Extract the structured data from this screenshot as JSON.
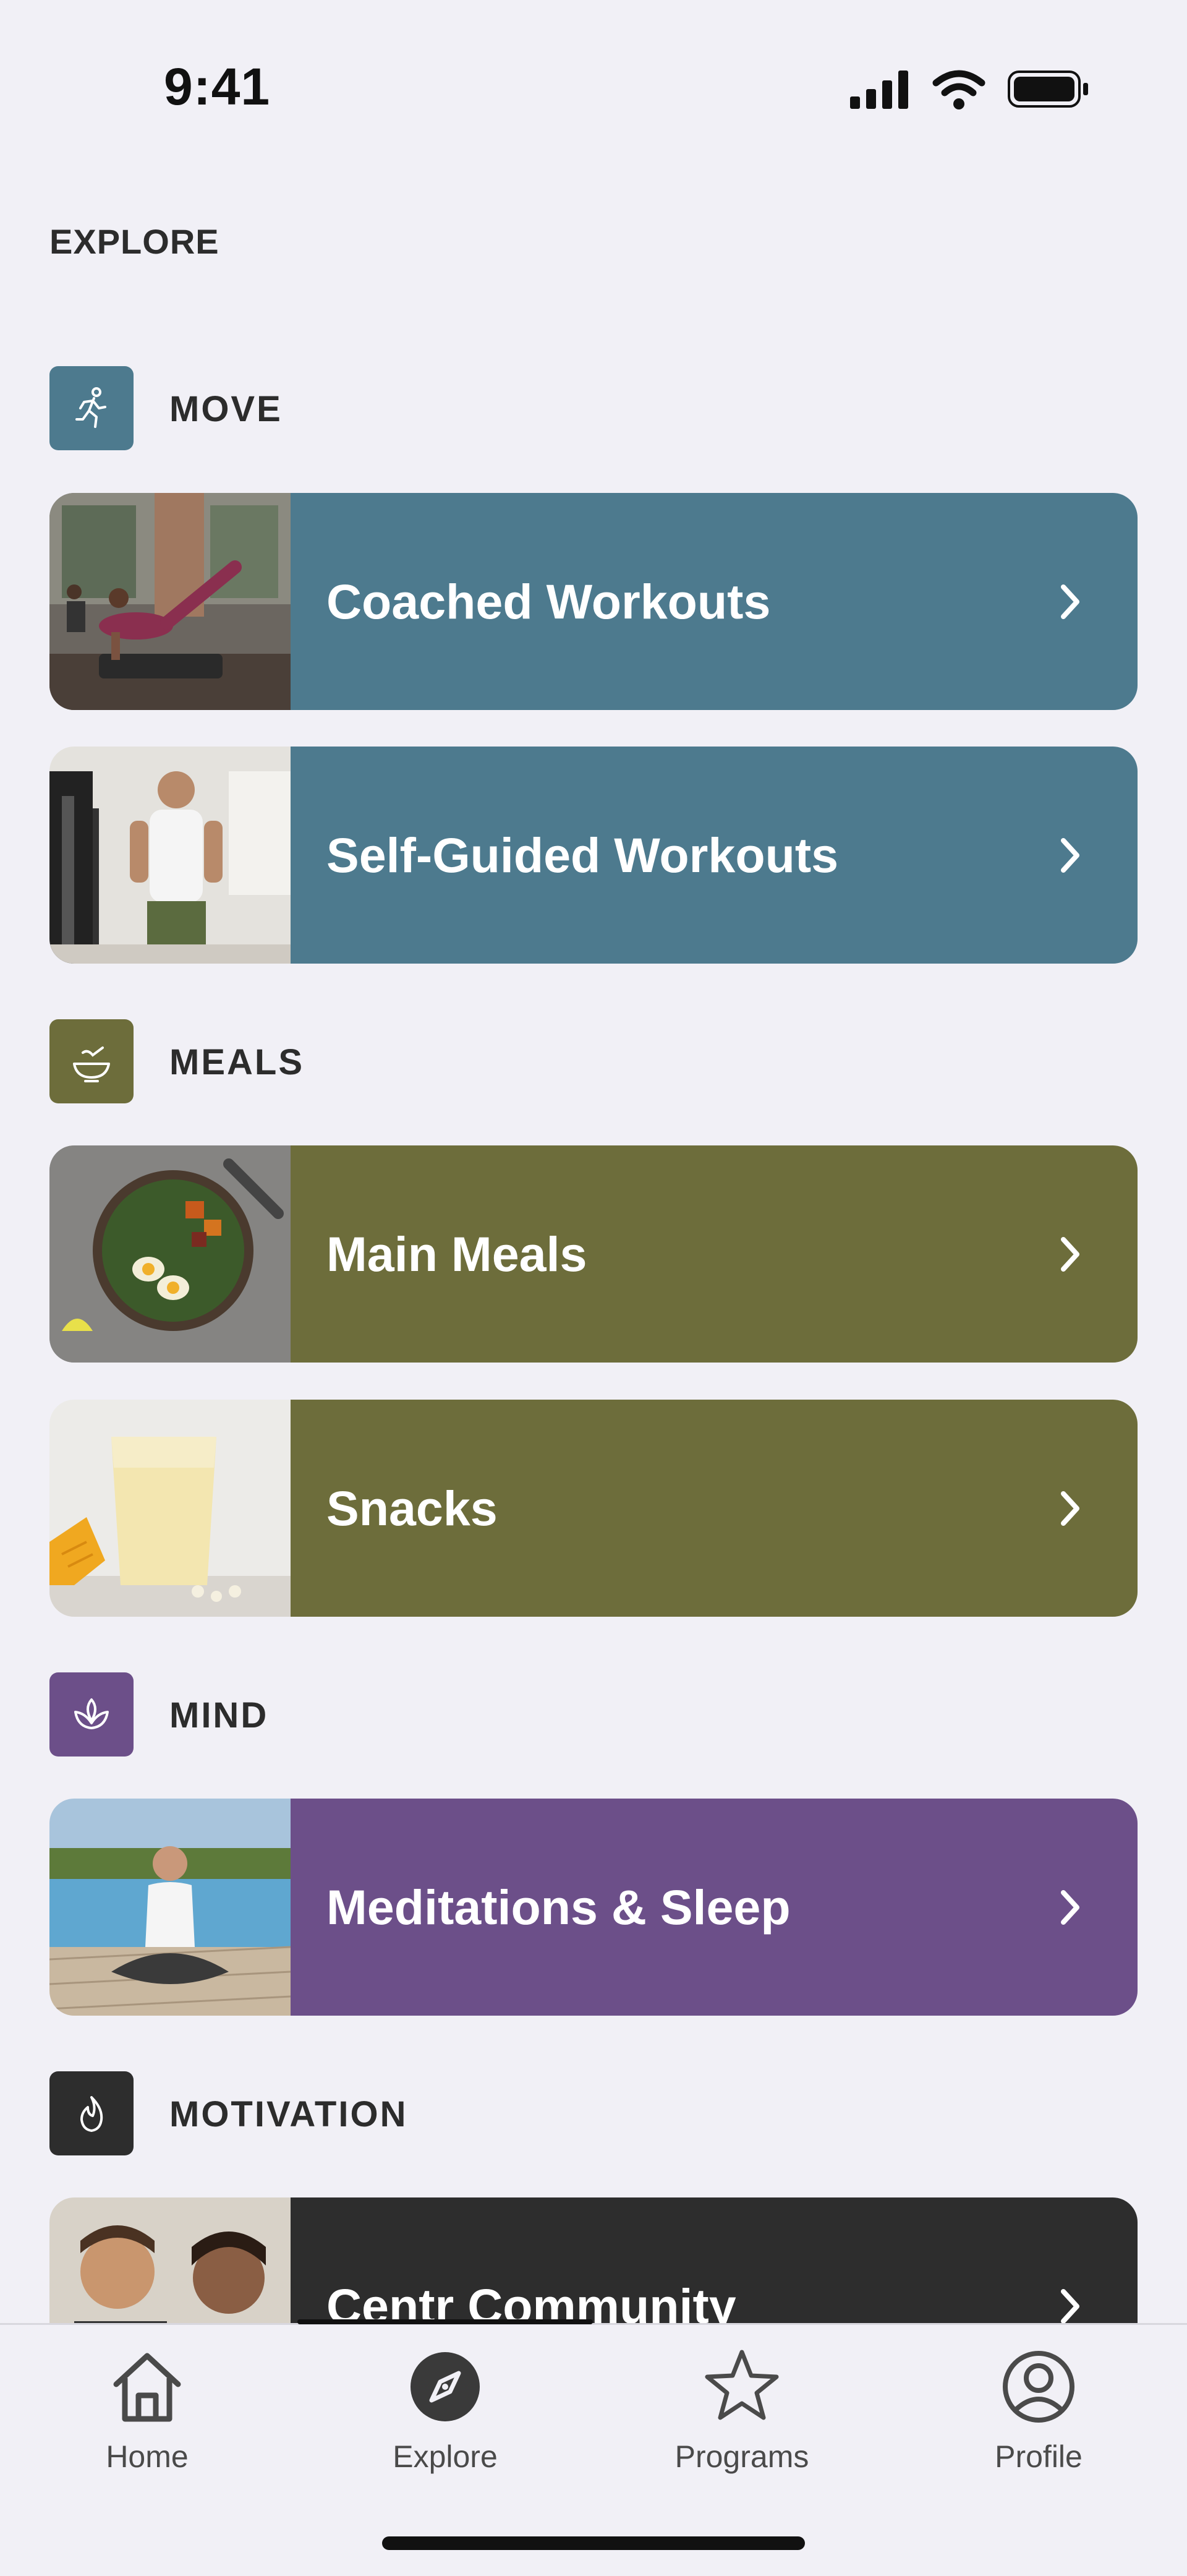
{
  "status_bar": {
    "time": "9:41"
  },
  "page": {
    "title": "EXPLORE"
  },
  "colors": {
    "background": "#f1f0f6",
    "move": "#4d7a8e",
    "meals": "#6d6d3b",
    "mind": "#6c4f89",
    "motivation": "#2d2d2d"
  },
  "sections": [
    {
      "label": "MOVE",
      "icon": "running-person-icon"
    },
    {
      "label": "MEALS",
      "icon": "bowl-icon"
    },
    {
      "label": "MIND",
      "icon": "lotus-icon"
    },
    {
      "label": "MOTIVATION",
      "icon": "flame-icon"
    }
  ],
  "cards": [
    {
      "title": "Coached Workouts",
      "image": "group-workout-photo"
    },
    {
      "title": "Self-Guided Workouts",
      "image": "cable-machine-photo"
    },
    {
      "title": "Main Meals",
      "image": "egg-bowl-photo"
    },
    {
      "title": "Snacks",
      "image": "mango-smoothie-photo"
    },
    {
      "title": "Meditations & Sleep",
      "image": "poolside-meditation-photo"
    },
    {
      "title": "Centr Community",
      "image": "smiling-couple-photo"
    }
  ],
  "tab_bar": {
    "selected": "Explore",
    "tabs": [
      {
        "label": "Home",
        "icon": "house-icon"
      },
      {
        "label": "Explore",
        "icon": "compass-icon"
      },
      {
        "label": "Programs",
        "icon": "star-icon"
      },
      {
        "label": "Profile",
        "icon": "person-circle-icon"
      }
    ]
  }
}
